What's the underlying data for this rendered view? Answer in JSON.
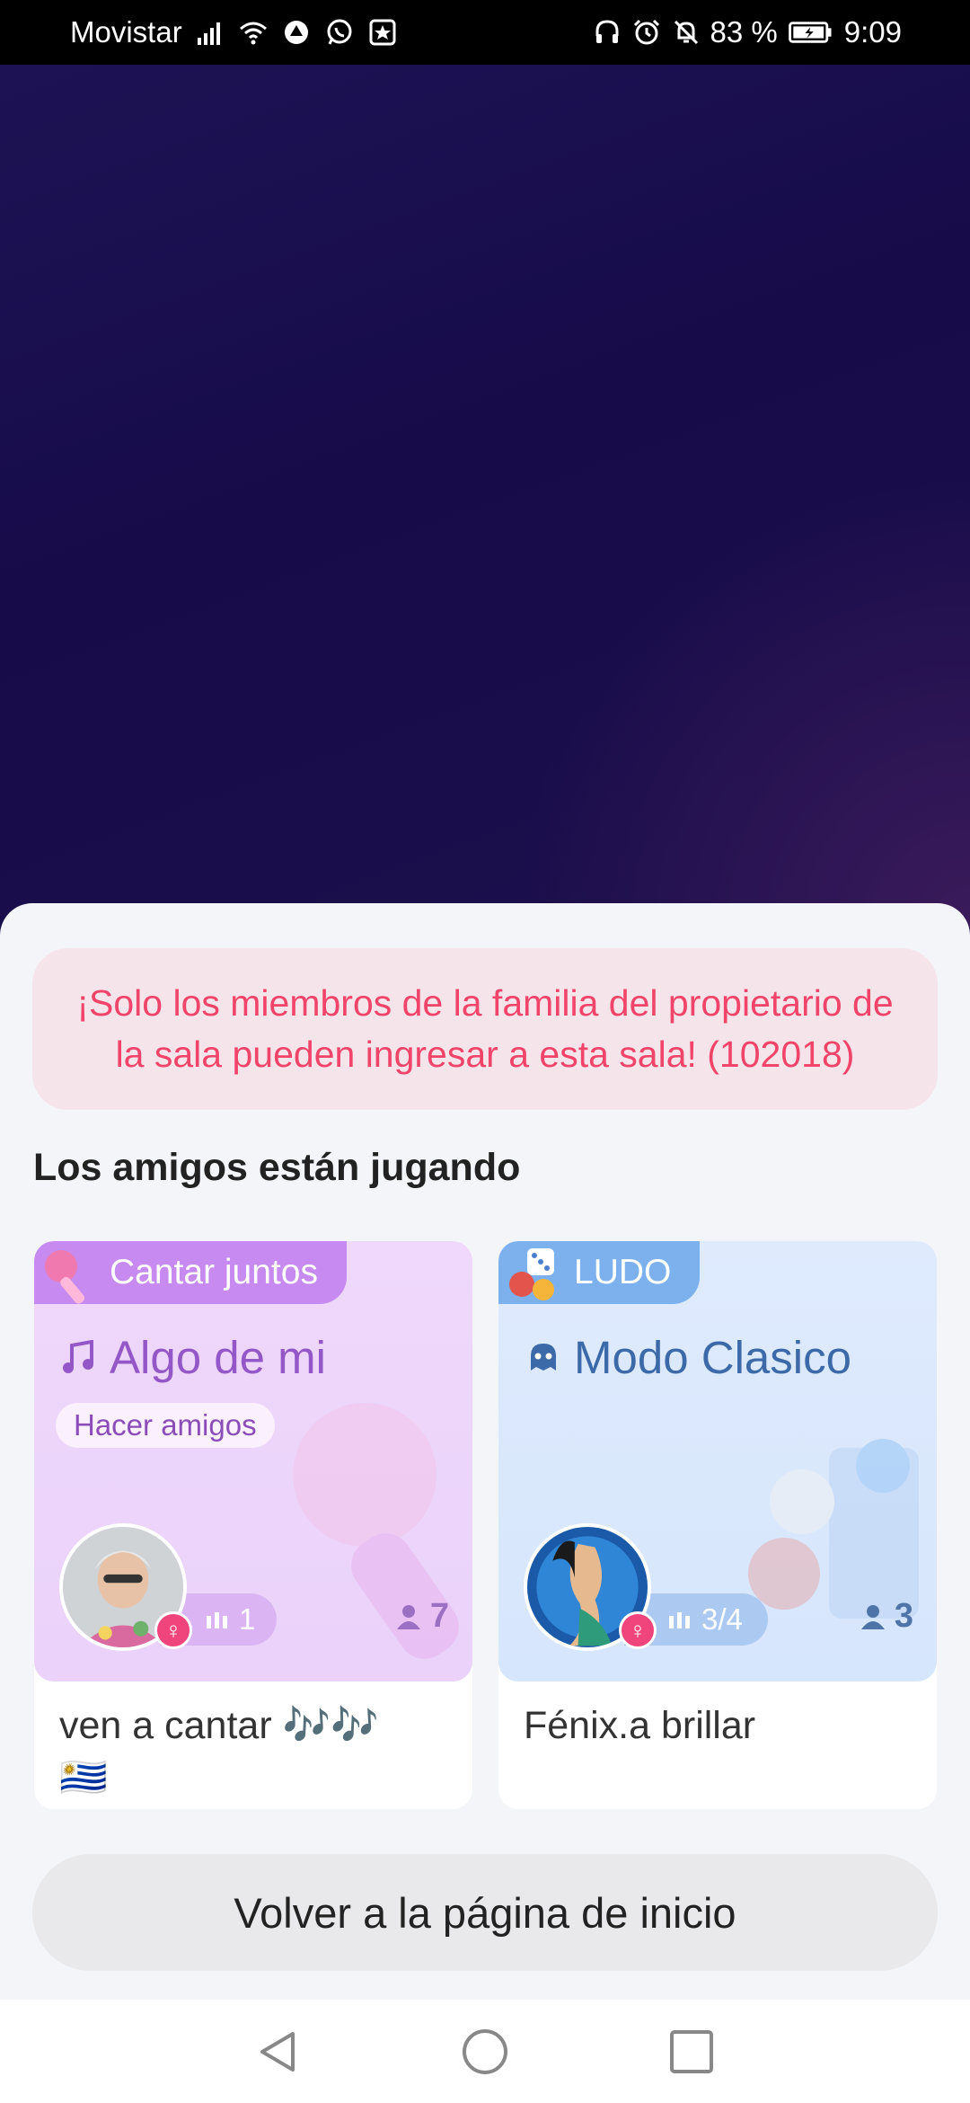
{
  "status_bar": {
    "carrier": "Movistar",
    "battery_percent": "83 %",
    "time": "9:09"
  },
  "alert": {
    "message": "¡Solo los miembros de la familia del propietario de la sala pueden ingresar a esta sala! (102018)"
  },
  "friends_section": {
    "title": "Los amigos están jugando",
    "cards": [
      {
        "tag": "Cantar juntos",
        "tag_icon": "microphone-icon",
        "room_icon": "music-note-icon",
        "room_title": "Algo de mi",
        "chip": "Hacer amigos",
        "level": "1",
        "people": "7",
        "description": "ven a cantar 🎶🎶",
        "flag": "🇺🇾"
      },
      {
        "tag": "LUDO",
        "tag_icon": "ludo-dice-icon",
        "room_icon": "game-ghost-icon",
        "room_title": "Modo Clasico",
        "level": "3/4",
        "people": "3",
        "description": "Fénix.a brillar"
      }
    ]
  },
  "home_button": {
    "label": "Volver a la página de inicio"
  },
  "colors": {
    "alert_text": "#f0446a",
    "alert_bg": "#f5e4ea",
    "sing_card": "#efd8fb",
    "ludo_card": "#dfeafd",
    "gender_badge": "#f0447c"
  }
}
